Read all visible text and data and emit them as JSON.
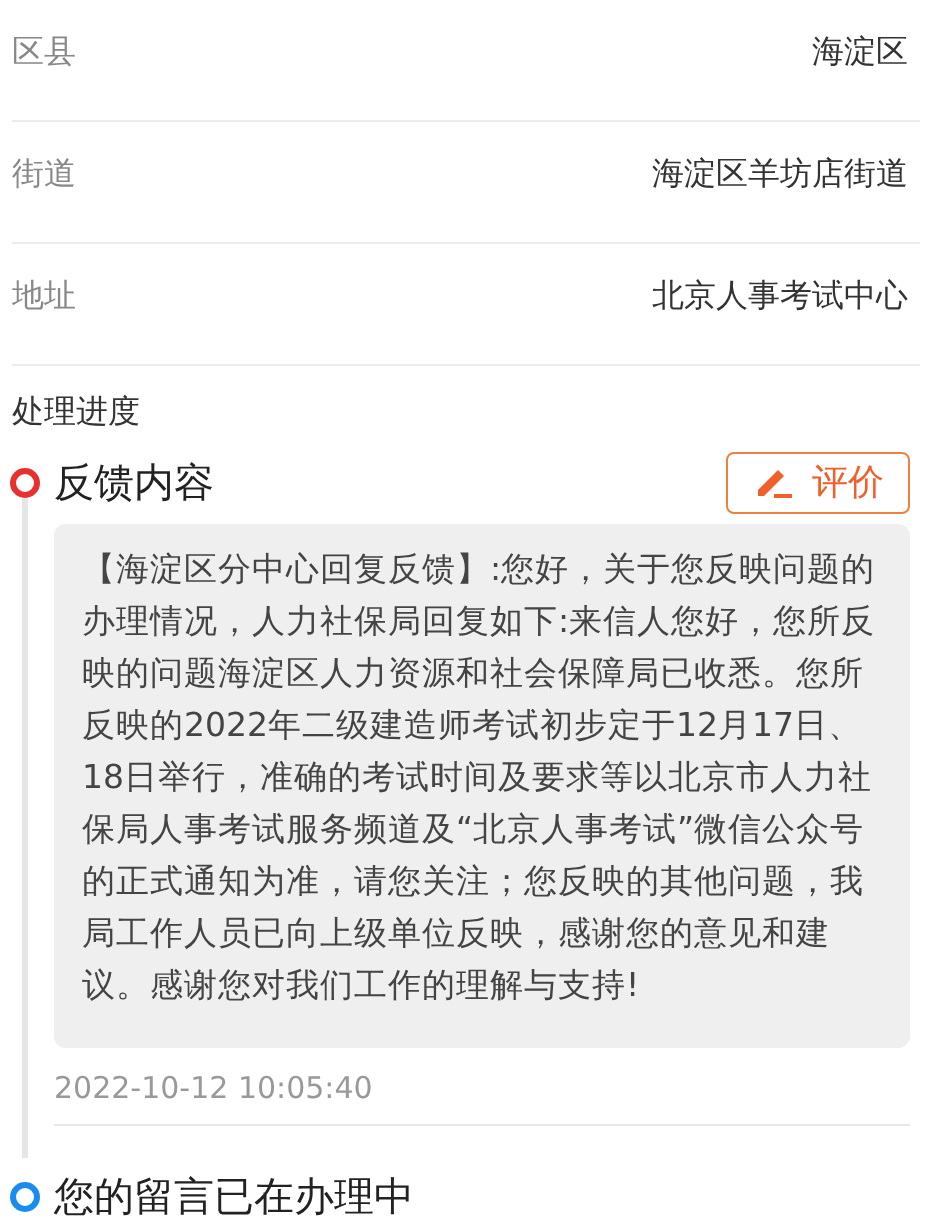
{
  "fields": [
    {
      "label": "区县",
      "value": "海淀区"
    },
    {
      "label": "街道",
      "value": "海淀区羊坊店街道"
    },
    {
      "label": "地址",
      "value": "北京人事考试中心"
    }
  ],
  "progress": {
    "title": "处理进度",
    "steps": [
      {
        "title": "反馈内容",
        "color": "#e8312f",
        "action": "评价",
        "content": "【海淀区分中心回复反馈】:您好，关于您反映问题的办理情况，人力社保局回复如下:来信人您好，您所反映的问题海淀区人力资源和社会保障局已收悉。您所反映的2022年二级建造师考试初步定于12月17日、18日举行，准确的考试时间及要求等以北京市人力社保局人事考试服务频道及“北京人事考试”微信公众号的正式通知为准，请您关注；您反映的其他问题，我局工作人员已向上级单位反映，感谢您的意见和建议。感谢您对我们工作的理解与支持!",
        "time": "2022-10-12 10:05:40"
      },
      {
        "title": "您的留言已在办理中",
        "color": "#1a8cf0"
      }
    ]
  }
}
